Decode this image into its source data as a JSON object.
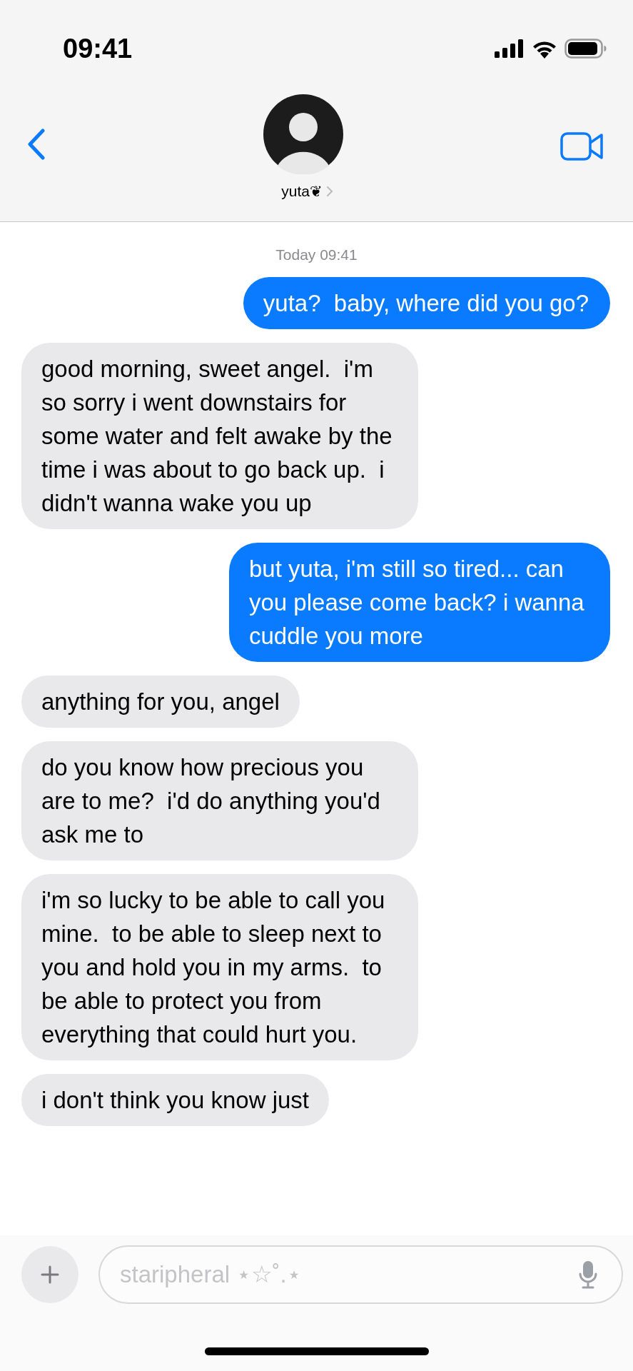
{
  "status_bar": {
    "time": "09:41"
  },
  "contact": {
    "name": "yuta❦"
  },
  "timestamp": {
    "day": "Today",
    "time": "09:41"
  },
  "messages": [
    {
      "outgoing": true,
      "text": "yuta?  baby, where did you go?"
    },
    {
      "outgoing": false,
      "text": "good morning, sweet angel.  i'm so sorry i went downstairs for some water and felt awake by the time i was about to go back up.  i didn't wanna wake you up"
    },
    {
      "outgoing": true,
      "text": "but yuta, i'm still so tired... can you please come back? i wanna cuddle you more"
    },
    {
      "outgoing": false,
      "text": "anything for you, angel"
    },
    {
      "outgoing": false,
      "text": "do you know how precious you are to me?  i'd do anything you'd ask me to"
    },
    {
      "outgoing": false,
      "text": "i'm so lucky to be able to call you mine.  to be able to sleep next to you and hold you in my arms.  to be able to protect you from everything that could hurt you."
    },
    {
      "outgoing": false,
      "text": "i don't think you know just"
    }
  ],
  "composer": {
    "placeholder": "staripheral ⋆☆˚.⋆"
  }
}
